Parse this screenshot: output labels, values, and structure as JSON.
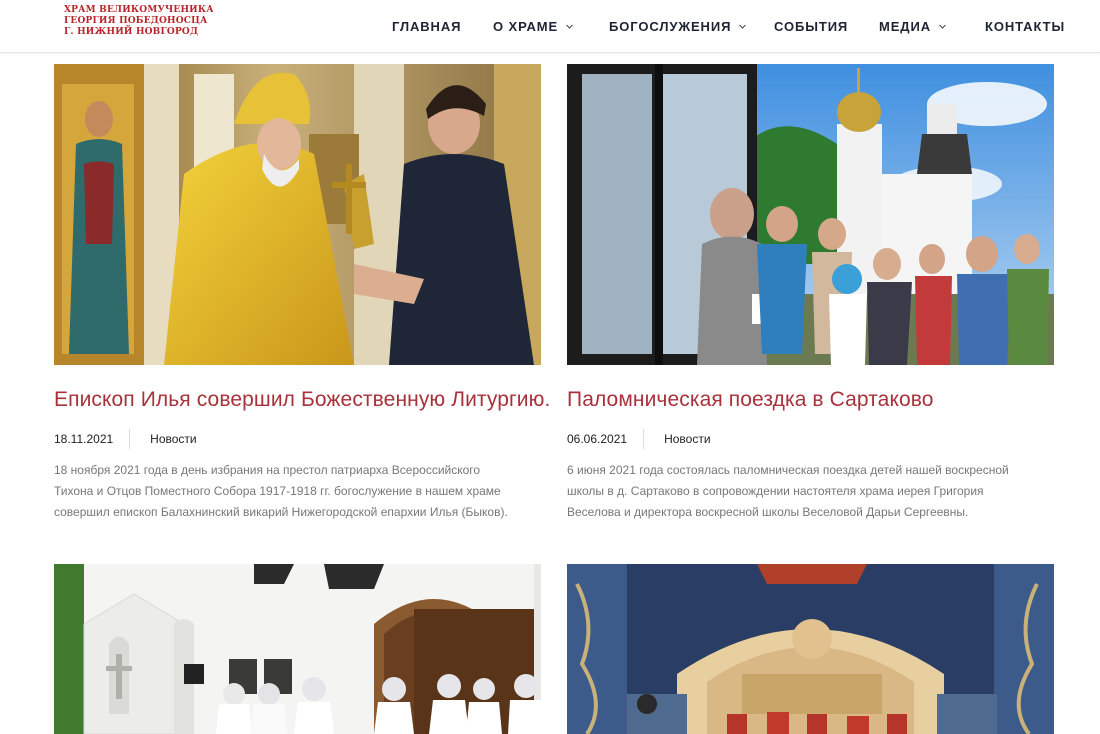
{
  "site": {
    "logo_lines": [
      "ХРАМ ВЕЛИКОМУЧЕНИКА",
      "ГЕОРГИЯ ПОБЕДОНОСЦА",
      "Г. НИЖНИЙ НОВГОРОД"
    ]
  },
  "nav": {
    "items": [
      {
        "label": "ГЛАВНАЯ",
        "has_dropdown": false
      },
      {
        "label": "О ХРАМЕ",
        "has_dropdown": true
      },
      {
        "label": "БОГОСЛУЖЕНИЯ",
        "has_dropdown": true
      },
      {
        "label": "СОБЫТИЯ",
        "has_dropdown": false
      },
      {
        "label": "МЕДИА",
        "has_dropdown": true
      },
      {
        "label": "КОНТАКТЫ",
        "has_dropdown": false
      }
    ]
  },
  "posts": [
    {
      "title": "Епископ Илья совершил Божественную Литургию.",
      "date": "18.11.2021",
      "category": "Новости",
      "excerpt_lines": [
        "18 ноября 2021 года в день избрания на престол патриарха Всероссийского",
        "Тихона и Отцов Поместного Собора 1917-1918 гг. богослужение в нашем храме",
        "совершил епископ Балахнинский викарий Нижегородской епархии Илья (Быков)."
      ]
    },
    {
      "title": "Паломническая поездка в Сартаково",
      "date": "06.06.2021",
      "category": "Новости",
      "excerpt_lines": [
        "6 июня 2021 года состоялась паломническая поездка детей нашей воскресной",
        "школы в д. Сартаково в сопровождении настоятеля храма иерея Григория",
        "Веселова и директора воскресной школы Веселовой Дарьи Сергеевны."
      ]
    }
  ],
  "colors": {
    "accent": "#a8323b",
    "logo": "#b8252b",
    "nav_text": "#1e2433",
    "excerpt_text": "#777777"
  }
}
